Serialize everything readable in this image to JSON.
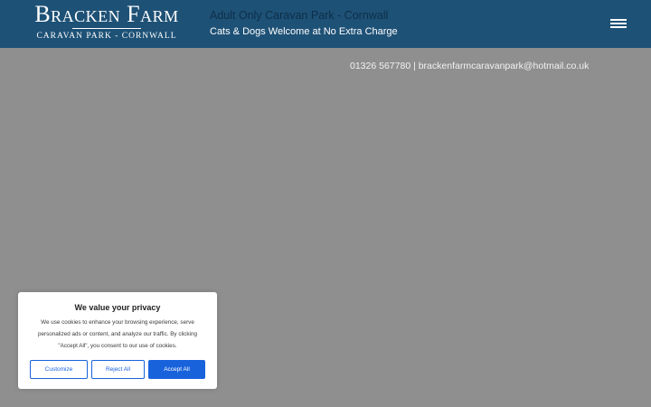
{
  "header": {
    "logo_title": "Bracken Farm",
    "logo_subtitle": "CARAVAN PARK - CORNWALL",
    "tagline_primary": "Adult Only Caravan Park - Cornwall",
    "tagline_secondary": "Cats & Dogs Welcome at No Extra Charge",
    "menu_icon": "hamburger-menu-icon",
    "background_color": "#1e5176"
  },
  "contact": {
    "phone": "01326 567780",
    "separator": " | ",
    "email": "brackenfarmcaravanpark@hotmail.co.uk"
  },
  "cookie_banner": {
    "title": "We value your privacy",
    "body": "We use cookies to enhance your browsing experience, serve personalized ads or content, and analyze our traffic. By clicking \"Accept All\", you consent to our use of cookies.",
    "customize_label": "Customize",
    "reject_label": "Reject All",
    "accept_label": "Accept All",
    "accent_color": "#1863dc"
  },
  "overlay_color": "#8f8f8f"
}
